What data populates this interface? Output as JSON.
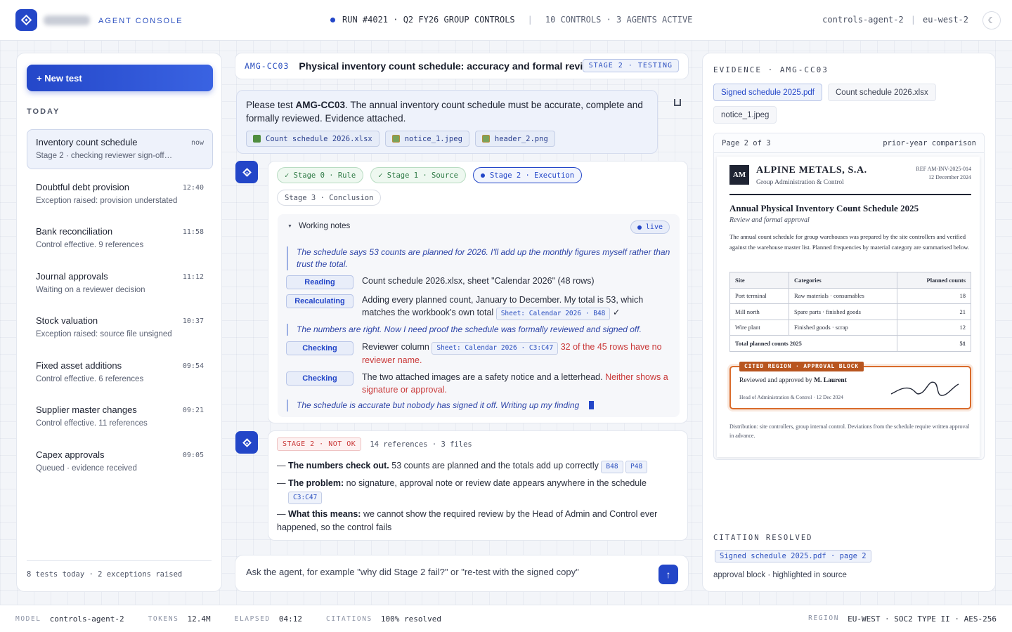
{
  "topbar": {
    "brand_subtitle": "AGENT CONSOLE",
    "run_label": "RUN #4021 · Q2 FY26 GROUP CONTROLS",
    "run_meta": "10 CONTROLS · 3 AGENTS ACTIVE",
    "agent_id": "controls-agent-2",
    "region": "eu-west-2",
    "theme_icon": "☾"
  },
  "sidebar": {
    "new_test_label": "+ New test",
    "section_label": "TODAY",
    "tests": [
      {
        "title": "Inventory count schedule",
        "time": "now",
        "subtitle": "Stage 2 · checking reviewer sign-off…"
      },
      {
        "title": "Doubtful debt provision",
        "time": "12:40",
        "subtitle": "Exception raised: provision understated"
      },
      {
        "title": "Bank reconciliation",
        "time": "11:58",
        "subtitle": "Control effective. 9 references"
      },
      {
        "title": "Journal approvals",
        "time": "11:12",
        "subtitle": "Waiting on a reviewer decision"
      },
      {
        "title": "Stock valuation",
        "time": "10:37",
        "subtitle": "Exception raised: source file unsigned"
      },
      {
        "title": "Fixed asset additions",
        "time": "09:54",
        "subtitle": "Control effective. 6 references"
      },
      {
        "title": "Supplier master changes",
        "time": "09:21",
        "subtitle": "Control effective. 11 references"
      },
      {
        "title": "Capex approvals",
        "time": "09:05",
        "subtitle": "Queued · evidence received"
      }
    ],
    "footer": "8 tests today · 2 exceptions raised"
  },
  "header": {
    "control_code": "AMG-CC03",
    "title": "Physical inventory count schedule: accuracy and formal review",
    "stage_badge": "STAGE 2 · TESTING"
  },
  "user_message": {
    "prefix": "Please test ",
    "code": "AMG-CC03",
    "suffix": ". The annual inventory count schedule must be accurate, complete and formally reviewed. Evidence attached.",
    "attachments": [
      "Count schedule 2026.xlsx",
      "notice_1.jpeg",
      "header_2.png"
    ]
  },
  "agent": {
    "stages": [
      {
        "label": "✓ Stage 0 · Rule"
      },
      {
        "label": "✓ Stage 1 · Source"
      },
      {
        "label": "Stage 2 · Execution"
      },
      {
        "label": "Stage 3 · Conclusion"
      }
    ],
    "working_notes_label": "Working notes",
    "live_label": "live",
    "thought_1": "The schedule says 53 counts are planned for 2026. I'll add up the monthly figures myself rather than trust the total.",
    "step_reading_label": "Reading",
    "step_reading_text": "Count schedule 2026.xlsx, sheet \"Calendar 2026\" (48 rows)",
    "step_recalc_label": "Recalculating",
    "step_recalc_text": "Adding every planned count, January to December. My total is 53, which matches the workbook's own total",
    "step_recalc_ref": "Sheet: Calendar 2026 · B48",
    "step_recalc_check": "✓",
    "thought_2": "The numbers are right. Now I need proof the schedule was formally reviewed and signed off.",
    "step_check1_label": "Checking",
    "step_check1_text": "Reviewer column",
    "step_check1_ref": "Sheet: Calendar 2026 · C3:C47",
    "step_check1_red": "32 of the 45 rows have no reviewer name.",
    "step_check2_label": "Checking",
    "step_check2_text": "The two attached images are a safety notice and a letterhead.",
    "step_check2_red": "Neither shows a signature or approval.",
    "thought_3": "The schedule is accurate but nobody has signed it off. Writing up my finding"
  },
  "result": {
    "badge": "STAGE 2 · NOT OK",
    "meta": "14 references · 3 files",
    "dash": "—",
    "f1_bold": "The numbers check out.",
    "f1_text": " 53 counts are planned and the totals add up correctly",
    "f1_refs": [
      "B48",
      "P48"
    ],
    "f2_bold": "The problem:",
    "f2_text": " no signature, approval note or review date appears anywhere in the schedule",
    "f2_ref": "C3:C47",
    "f3_bold": "What this means:",
    "f3_text": " we cannot show the required review by the Head of Admin and Control ever happened, so the control fails"
  },
  "composer": {
    "placeholder": "Ask the agent, for example \"why did Stage 2 fail?\" or \"re-test with the signed copy\"",
    "send_icon": "↑"
  },
  "evidence": {
    "title": "EVIDENCE · AMG-CC03",
    "tabs": [
      "Signed schedule 2025.pdf",
      "Count schedule 2026.xlsx",
      "notice_1.jpeg"
    ],
    "page_label": "Page 2 of 3",
    "page_note": "prior-year comparison",
    "doc": {
      "logo": "AM",
      "company": "ALPINE METALS, S.A.",
      "department": "Group Administration & Control",
      "ref": "REF AM-INV-2025-014",
      "date": "12 December 2024",
      "title": "Annual Physical Inventory Count Schedule 2025",
      "subtitle": "Review and formal approval",
      "body": "The annual count schedule for group warehouses was prepared by the site controllers and verified against the warehouse master list. Planned frequencies by material category are summarised below.",
      "table": {
        "headers": [
          "Site",
          "Categories",
          "Planned counts"
        ],
        "rows": [
          [
            "Port terminal",
            "Raw materials · consumables",
            "18"
          ],
          [
            "Mill north",
            "Spare parts · finished goods",
            "21"
          ],
          [
            "Wire plant",
            "Finished goods · scrap",
            "12"
          ]
        ],
        "total_label": "Total planned counts 2025",
        "total_value": "51"
      },
      "approval_tag": "CITED REGION · APPROVAL BLOCK",
      "approval_prefix": "Reviewed and approved by ",
      "approval_name": "M. Laurent",
      "approval_role": "Head of Administration & Control · 12 Dec 2024",
      "footer": "Distribution: site controllers, group internal control. Deviations from the schedule require written approval in advance."
    },
    "citation_title": "CITATION RESOLVED",
    "citation_chip": "Signed schedule 2025.pdf · page 2",
    "citation_note": "approval block · highlighted in source"
  },
  "footer": {
    "model_key": "MODEL",
    "model_val": "controls-agent-2",
    "tokens_key": "TOKENS",
    "tokens_val": "12.4M",
    "elapsed_key": "ELAPSED",
    "elapsed_val": "04:12",
    "citations_key": "CITATIONS",
    "citations_val": "100% resolved",
    "region_key": "REGION",
    "region_val": "EU-WEST · SOC2 TYPE II · AES-256"
  }
}
